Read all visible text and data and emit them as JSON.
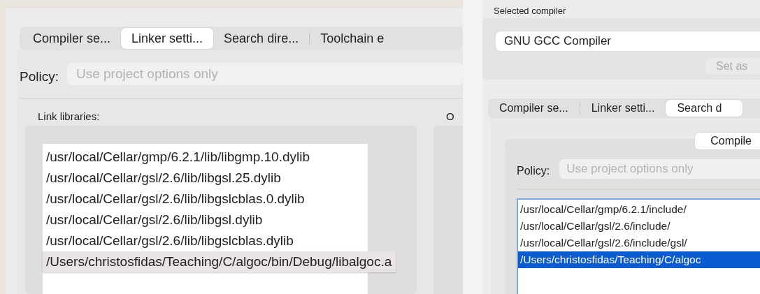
{
  "left_window": {
    "tabs": [
      {
        "label": "Compiler se...",
        "selected": false
      },
      {
        "label": "Linker setti...",
        "selected": true
      },
      {
        "label": "Search dire...",
        "selected": false
      },
      {
        "label": "Toolchain e",
        "selected": false
      }
    ],
    "policy": {
      "label": "Policy:",
      "placeholder": "Use project options only"
    },
    "link_libraries": {
      "label": "Link libraries:",
      "items": [
        {
          "text": "/usr/local/Cellar/gmp/6.2.1/lib/libgmp.10.dylib",
          "selected": false
        },
        {
          "text": "/usr/local/Cellar/gsl/2.6/lib/libgsl.25.dylib",
          "selected": false
        },
        {
          "text": "/usr/local/Cellar/gsl/2.6/lib/libgslcblas.0.dylib",
          "selected": false
        },
        {
          "text": "/usr/local/Cellar/gsl/2.6/lib/libgsl.dylib",
          "selected": false
        },
        {
          "text": "/usr/local/Cellar/gsl/2.6/lib/libgslcblas.dylib",
          "selected": false
        },
        {
          "text": "/Users/christosfidas/Teaching/C/algoc/bin/Debug/libalgoc.a",
          "selected": true
        }
      ]
    },
    "other_label": "O"
  },
  "right_window": {
    "selected_compiler": {
      "label": "Selected compiler",
      "value": "GNU GCC Compiler",
      "button": {
        "label": "Set as",
        "disabled": true
      }
    },
    "tabs": [
      {
        "label": "Compiler se...",
        "selected": false
      },
      {
        "label": "Linker setti...",
        "selected": false
      },
      {
        "label": "Search d",
        "selected": true
      }
    ],
    "subtab": {
      "label": "Compile",
      "selected": true
    },
    "policy": {
      "label": "Policy:",
      "placeholder": "Use project options only"
    },
    "search_directories": {
      "items": [
        {
          "text": "/usr/local/Cellar/gmp/6.2.1/include/",
          "selected": false
        },
        {
          "text": "/usr/local/Cellar/gsl/2.6/include/",
          "selected": false
        },
        {
          "text": "/usr/local/Cellar/gsl/2.6/include/gsl/",
          "selected": false
        },
        {
          "text": "/Users/christosfidas/Teaching/C/algoc",
          "selected": true
        }
      ]
    }
  }
}
